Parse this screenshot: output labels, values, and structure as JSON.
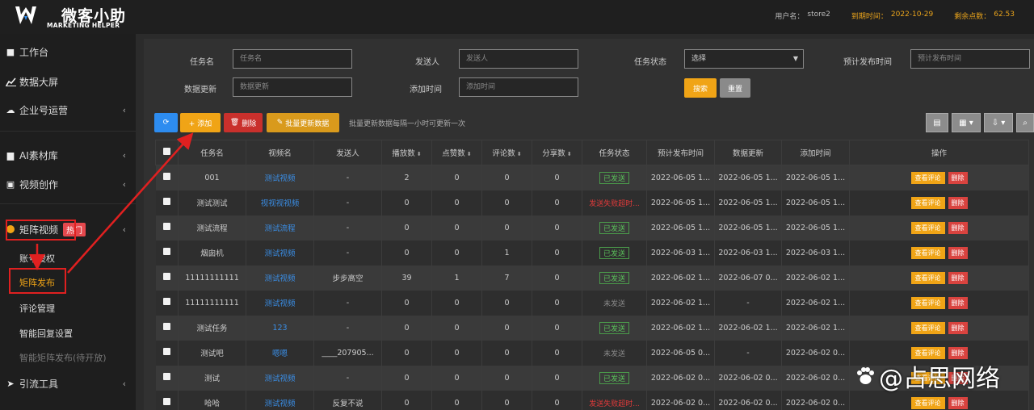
{
  "header": {
    "logo_title": "微客小助",
    "logo_subtitle": "MARKETING HELPER",
    "username_label": "用户名：",
    "username": "store2",
    "expire_label": "到期时间：",
    "expire_date": "2022-10-29",
    "points_label": "剩余点数：",
    "points": "62.53"
  },
  "sidebar": {
    "items": [
      {
        "label": "工作台",
        "icon": "workbench-icon"
      },
      {
        "label": "数据大屏",
        "icon": "chart-icon"
      },
      {
        "label": "企业号运营",
        "icon": "cloud-icon"
      },
      {
        "label": "AI素材库",
        "icon": "folder-icon"
      },
      {
        "label": "视频创作",
        "icon": "film-icon"
      },
      {
        "label": "矩阵视频",
        "icon": "video-icon"
      },
      {
        "label": "引流工具",
        "icon": "send-icon"
      }
    ],
    "hot_badge": "热门",
    "sub_items": [
      "账号授权",
      "矩阵发布",
      "评论管理",
      "智能回复设置",
      "智能矩阵发布(待开放)"
    ]
  },
  "filters": {
    "task_name_label": "任务名",
    "task_name_placeholder": "任务名",
    "sender_label": "发送人",
    "sender_placeholder": "发送人",
    "task_status_label": "任务状态",
    "task_status_value": "选择",
    "plan_time_label": "预计发布时间",
    "plan_time_placeholder": "预计发布时间",
    "data_update_label": "数据更新",
    "data_update_placeholder": "数据更新",
    "add_time_label": "添加时间",
    "add_time_placeholder": "添加时间",
    "search_button": "搜索",
    "reset_button": "重置"
  },
  "toolbar": {
    "add_button": "+ 添加",
    "delete_button": "删除",
    "batch_update_button": "批量更新数据",
    "note": "批量更新数据每隔一小时可更新一次"
  },
  "table": {
    "headers": [
      "任务名",
      "视频名",
      "发送人",
      "播放数",
      "点赞数",
      "评论数",
      "分享数",
      "任务状态",
      "预计发布时间",
      "数据更新",
      "添加时间",
      "操作"
    ],
    "op_view": "查看评论",
    "op_delete": "删除",
    "rows": [
      {
        "task": "001",
        "video": "测试视频",
        "sender": "-",
        "play": "2",
        "like": "0",
        "comment": "0",
        "share": "0",
        "status": "已发送",
        "status_type": "green",
        "plan": "2022-06-05 1...",
        "update": "2022-06-05 1...",
        "added": "2022-06-05 1..."
      },
      {
        "task": "测试测试",
        "video": "视视视视频",
        "sender": "-",
        "play": "0",
        "like": "0",
        "comment": "0",
        "share": "0",
        "status": "发送失败超时...",
        "status_type": "red",
        "plan": "2022-06-05 1...",
        "update": "2022-06-05 1...",
        "added": "2022-06-05 1..."
      },
      {
        "task": "测试流程",
        "video": "测试流程",
        "sender": "-",
        "play": "0",
        "like": "0",
        "comment": "0",
        "share": "0",
        "status": "已发送",
        "status_type": "green",
        "plan": "2022-06-05 1...",
        "update": "2022-06-05 1...",
        "added": "2022-06-05 1..."
      },
      {
        "task": "烟囱机",
        "video": "测试视频",
        "sender": "-",
        "play": "0",
        "like": "0",
        "comment": "1",
        "share": "0",
        "status": "已发送",
        "status_type": "green",
        "plan": "2022-06-03 1...",
        "update": "2022-06-03 1...",
        "added": "2022-06-03 1..."
      },
      {
        "task": "11111111111",
        "video": "测试视频",
        "sender": "步步高空",
        "play": "39",
        "like": "1",
        "comment": "7",
        "share": "0",
        "status": "已发送",
        "status_type": "green",
        "plan": "2022-06-02 1...",
        "update": "2022-06-07 0...",
        "added": "2022-06-02 1..."
      },
      {
        "task": "11111111111",
        "video": "测试视频",
        "sender": "-",
        "play": "0",
        "like": "0",
        "comment": "0",
        "share": "0",
        "status": "未发送",
        "status_type": "gray",
        "plan": "2022-06-02 1...",
        "update": "-",
        "added": "2022-06-02 1..."
      },
      {
        "task": "测试任务",
        "video": "123",
        "sender": "-",
        "play": "0",
        "like": "0",
        "comment": "0",
        "share": "0",
        "status": "已发送",
        "status_type": "green",
        "plan": "2022-06-02 1...",
        "update": "2022-06-02 1...",
        "added": "2022-06-02 1..."
      },
      {
        "task": "测试吧",
        "video": "嗯嗯",
        "sender": "____207905...",
        "play": "0",
        "like": "0",
        "comment": "0",
        "share": "0",
        "status": "未发送",
        "status_type": "gray",
        "plan": "2022-06-05 0...",
        "update": "-",
        "added": "2022-06-02 0..."
      },
      {
        "task": "测试",
        "video": "测试视频",
        "sender": "-",
        "play": "0",
        "like": "0",
        "comment": "0",
        "share": "0",
        "status": "已发送",
        "status_type": "green",
        "plan": "2022-06-02 0...",
        "update": "2022-06-02 0...",
        "added": "2022-06-02 0..."
      },
      {
        "task": "哈哈",
        "video": "测试视频",
        "sender": "反复不说",
        "play": "0",
        "like": "0",
        "comment": "0",
        "share": "0",
        "status": "发送失败超时...",
        "status_type": "red",
        "plan": "2022-06-02 0...",
        "update": "2022-06-02 0...",
        "added": "2022-06-02 0..."
      }
    ]
  },
  "watermark": "@占思网络"
}
